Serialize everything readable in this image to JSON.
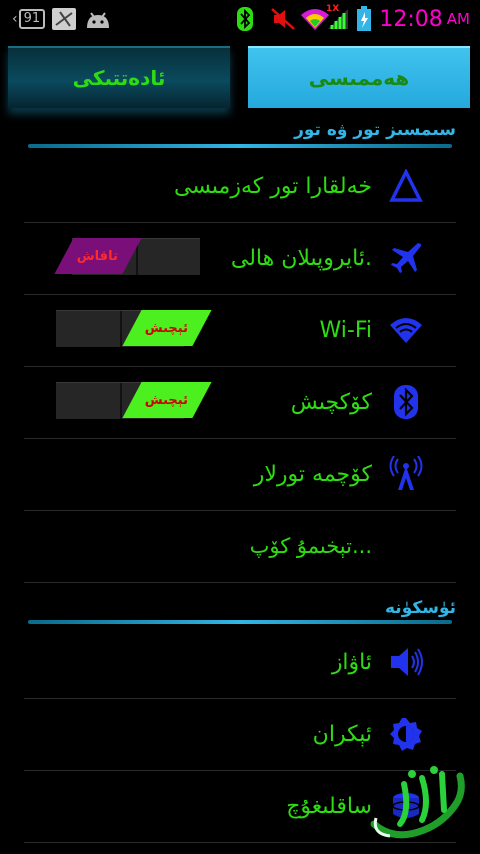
{
  "status_bar": {
    "badge": "91",
    "time": "12:08",
    "ampm": "AM",
    "signal_label": "1X"
  },
  "tabs": {
    "left": "ئادەتتىكى",
    "right": "ھەممىسى"
  },
  "sections": {
    "wireless": "سىمسىز تور ۋە تور",
    "device": "ئۈسكۈنە"
  },
  "rows": {
    "mobile_network": "خەلقارا تور كەزمىسى",
    "airplane": "ئايروپىلان ھالى.",
    "airplane_toggle": "تاقاش",
    "wifi": "Wi-Fi",
    "wifi_toggle": "ئېچىش",
    "bluetooth": "كۆكچىش",
    "bluetooth_toggle": "ئېچىش",
    "data_usage": "كۆچمە تورلار",
    "more": "تېخىمۇ كۆپ...",
    "sound": "ئاۋاز",
    "display": "ئېكران",
    "storage": "ساقلىغۇچ"
  },
  "colors": {
    "accent": "#33b5e5",
    "label_green": "#2edc12",
    "icon_blue": "#2233ee",
    "clock_pink": "#ff00cc"
  }
}
